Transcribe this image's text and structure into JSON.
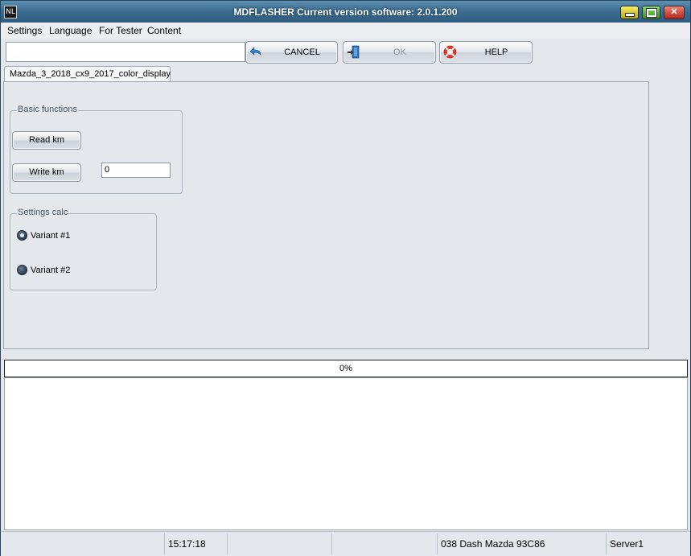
{
  "window": {
    "title": "MDFLASHER  Current version software: 2.0.1.200",
    "app_icon": "NL"
  },
  "menu": [
    "Settings",
    "Language",
    "For Tester",
    "Content"
  ],
  "toolbar": {
    "input_value": "",
    "cancel_label": "CANCEL",
    "ok_label": "OK",
    "help_label": "HELP"
  },
  "tab": {
    "label": "Mazda_3_2018_cx9_2017_color_display"
  },
  "basic_functions": {
    "title": "Basic functions",
    "read_km_label": "Read km",
    "write_km_label": "Write km",
    "km_value": "0"
  },
  "settings_calc": {
    "title": "Settings calc",
    "options": [
      {
        "label": "Variant #1",
        "checked": true
      },
      {
        "label": "Variant #2",
        "checked": false
      }
    ]
  },
  "progress": {
    "value": 0,
    "text": "0%"
  },
  "status": {
    "time": "15:17:18",
    "device": "038 Dash Mazda  93C86",
    "server": "Server1"
  },
  "colors": {
    "titlebar": "#3d6e93",
    "window_bg": "#e4e7eb",
    "progress_fill": "#4f8fd6"
  },
  "icons": {
    "cancel": "undo-arrow-icon",
    "ok": "door-exit-icon",
    "help": "lifebuoy-icon"
  }
}
